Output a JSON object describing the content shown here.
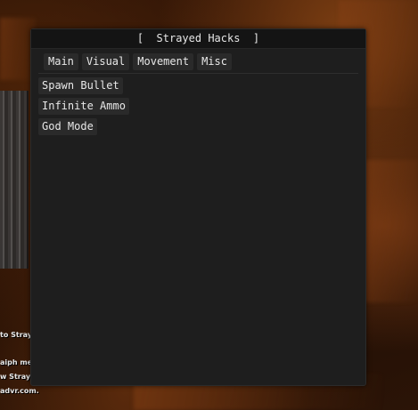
{
  "window": {
    "title": "[  Strayed Hacks  ]",
    "tabs": [
      {
        "label": "Main"
      },
      {
        "label": "Visual"
      },
      {
        "label": "Movement"
      },
      {
        "label": "Misc"
      }
    ],
    "options": [
      {
        "label": "Spawn Bullet"
      },
      {
        "label": "Infinite Ammo"
      },
      {
        "label": "God Mode"
      }
    ]
  },
  "background_text": [
    {
      "text": "to Stray"
    },
    {
      "text": "aiph mea"
    },
    {
      "text": "w Straye"
    },
    {
      "text": "advr.com."
    }
  ],
  "colors": {
    "window_bg": "#1e1e1e",
    "titlebar_bg": "#141414",
    "button_bg": "#2a2a2a",
    "text": "#e8e8e8",
    "cave_orange": "#7a3d12"
  }
}
